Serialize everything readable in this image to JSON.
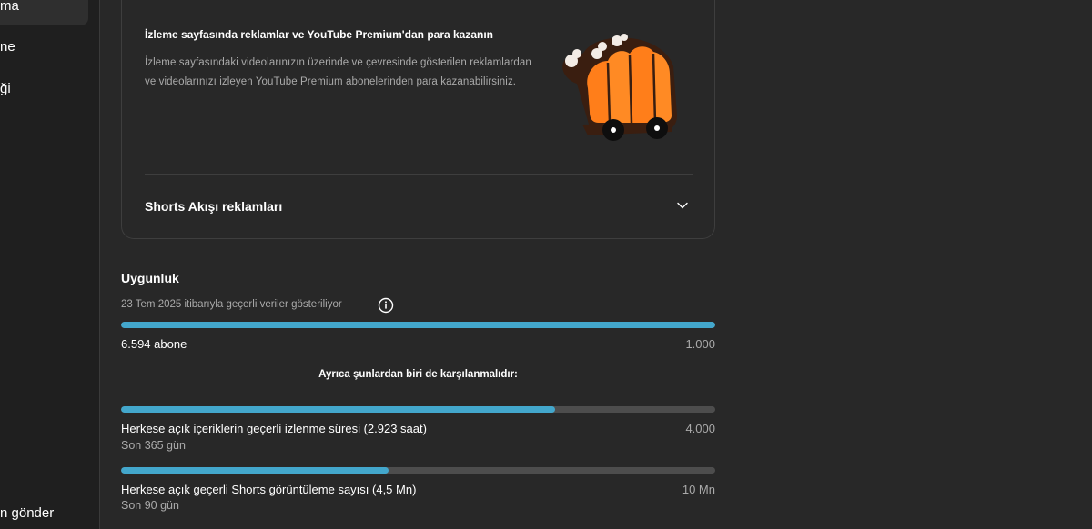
{
  "sidebar": {
    "items": [
      {
        "label": "ma",
        "active": true
      },
      {
        "label": "ne"
      },
      {
        "label": "ği"
      },
      {
        "label": "n gönder"
      }
    ]
  },
  "card": {
    "title": "İzleme sayfasında reklamlar ve YouTube Premium'dan para kazanın",
    "description": "İzleme sayfasındaki videolarınızın üzerinde ve çevresinde gösterilen reklamlardan ve videolarınızı izleyen YouTube Premium abonelerinden para kazanabilirsiniz.",
    "illustration_icon": "orange-bus-illustration",
    "shorts_row_label": "Shorts Akışı reklamları",
    "shorts_row_icon": "chevron-down-icon"
  },
  "eligibility": {
    "title": "Uygunluk",
    "subtitle": "23 Tem 2025 itibarıyla geçerli veriler gösteriliyor",
    "info_icon": "info-icon",
    "subscribers": {
      "label": "6.594 abone",
      "target": "1.000",
      "progress": 1.0
    },
    "also_note": "Ayrıca şunlardan biri de karşılanmalıdır:",
    "watch_hours": {
      "label": "Herkese açık içeriklerin geçerli izlenme süresi (2.923 saat)",
      "target": "4.000",
      "period": "Son 365 gün",
      "progress": 0.731
    },
    "shorts_views": {
      "label": "Herkese açık geçerli Shorts görüntüleme sayısı (4,5 Mn)",
      "target": "10 Mn",
      "period": "Son 90 gün",
      "progress": 0.45
    }
  },
  "colors": {
    "background": "#282828",
    "sidebar": "#1f1f1f",
    "progress_fill": "#43a7cc",
    "progress_track": "#4d4d4d",
    "muted_text": "#aaaaaa"
  }
}
